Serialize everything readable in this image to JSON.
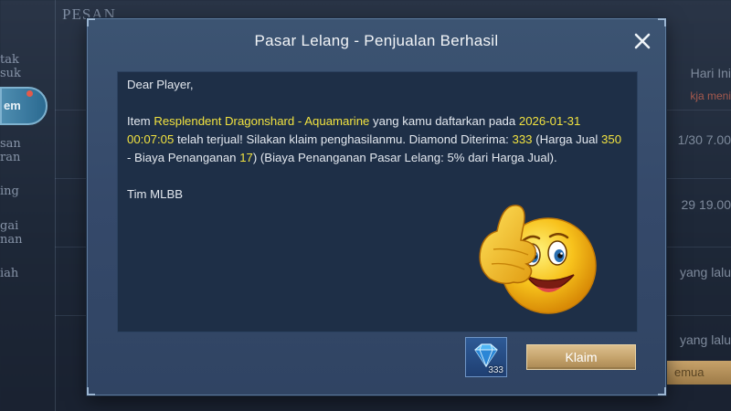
{
  "background": {
    "title": "PESAN",
    "left_items": [
      "tak\nsuk",
      "em",
      "san\nran",
      "ing",
      "gai\nnan",
      "iah"
    ],
    "right_items": {
      "today": "Hari Ini",
      "today_sub": "kja meni",
      "time1": "1/30 7.00",
      "time2": "29 19.00",
      "ago1": "yang lalu",
      "ago2": "yang lalu",
      "button": "emua"
    }
  },
  "dialog": {
    "title": "Pasar Lelang - Penjualan Berhasil",
    "message": {
      "greeting": "Dear Player,",
      "item_prefix": "Item ",
      "item_name": "Resplendent Dragonshard - Aquamarine",
      "text_after_item": " yang kamu daftarkan pada ",
      "date": "2026-01-31 00:07:05",
      "text_after_date": " telah terjual! Silakan klaim penghasilanmu. Diamond Diterima: ",
      "diamonds_received": "333",
      "text_price": " (Harga Jual ",
      "sell_price": "350",
      "text_fee": " - Biaya Penanganan ",
      "fee": "17",
      "text_end": ") (Biaya Penanganan Pasar Lelang: 5% dari Harga Jual).",
      "signature": "Tim MLBB"
    },
    "reward": {
      "icon": "diamond-icon",
      "count": "333"
    },
    "claim_label": "Klaim"
  },
  "colors": {
    "highlight": "#f1e240",
    "dialog_bg": "#3a5170",
    "panel_bg": "#1e2f47",
    "claim_button": "#c4a26b"
  }
}
